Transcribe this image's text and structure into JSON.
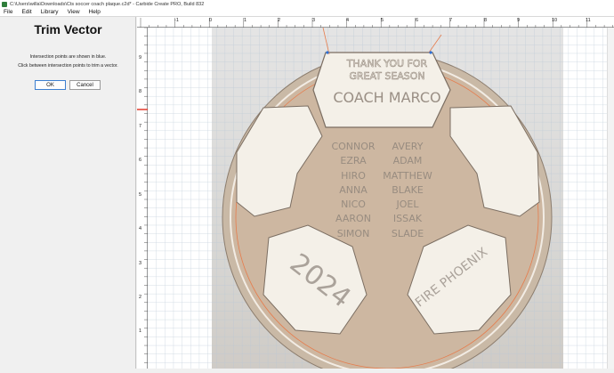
{
  "window": {
    "title": "C:\\Users\\willa\\Downloads\\Cts soccer coach plaque.c2d* - Carbide Create PRO, Build 832"
  },
  "menu": {
    "items": [
      "File",
      "Edit",
      "Library",
      "View",
      "Help"
    ]
  },
  "trim_panel": {
    "title": "Trim Vector",
    "instruction_1": "Intersection points are shown in blue.",
    "instruction_2": "Click between intersection points to trim a vector.",
    "ok_label": "OK",
    "cancel_label": "Cancel"
  },
  "rulers": {
    "top_labels": [
      "-1",
      "0",
      "1",
      "2",
      "3",
      "4",
      "5",
      "6",
      "7",
      "8",
      "9",
      "10",
      "11"
    ],
    "left_labels": [
      "9",
      "8",
      "7",
      "6",
      "5",
      "4",
      "3",
      "2",
      "1"
    ]
  },
  "design": {
    "banner_line_1": "THANK YOU FOR",
    "banner_line_2": "GREAT SEASON",
    "coach": "COACH MARCO",
    "names_left": [
      "CONNOR",
      "EZRA",
      "HIRO",
      "ANNA",
      "NICO",
      "AARON",
      "SIMON"
    ],
    "names_right": [
      "AVERY",
      "ADAM",
      "MATTHEW",
      "BLAKE",
      "JOEL",
      "ISSAK",
      "SLADE"
    ],
    "year": "2024",
    "team": "FIRE PHOENIX"
  },
  "colors": {
    "accent_red": "#e23b2e",
    "vector_orange": "#e67c4c",
    "wood_light": "#f4f0e8",
    "wood_dark": "#c8a98f"
  }
}
